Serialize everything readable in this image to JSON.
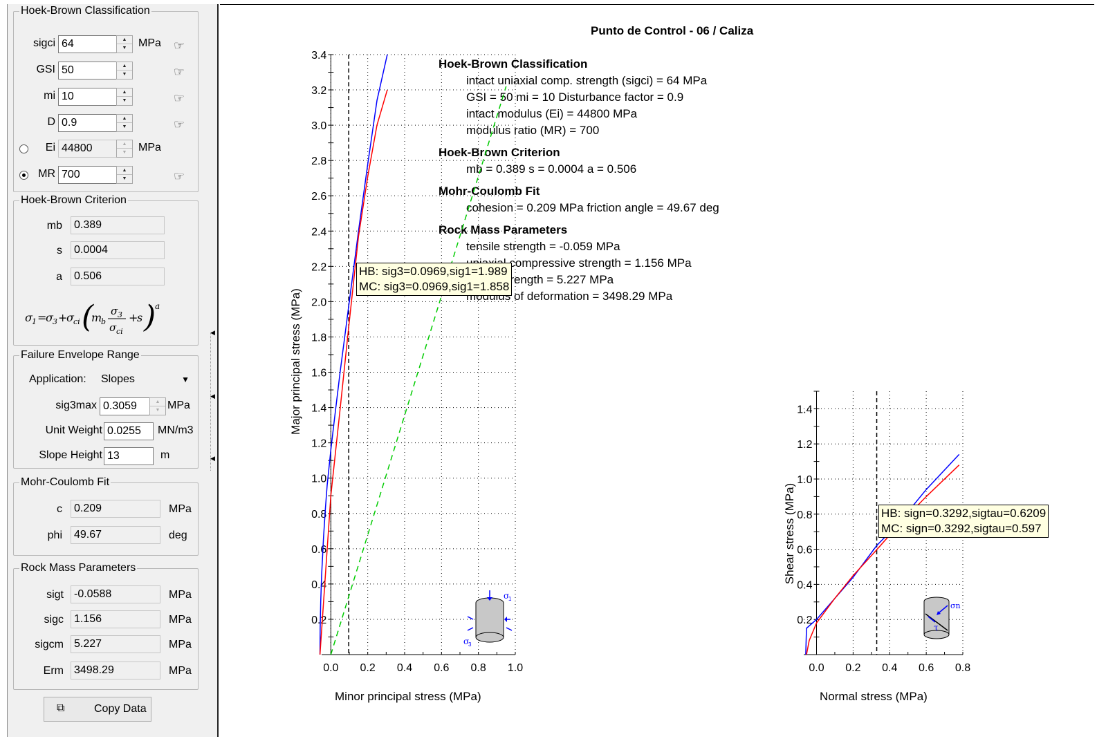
{
  "colors": {
    "hb": "#0000ff",
    "mc": "#ff0000",
    "uniaxial": "#00cc00"
  },
  "left_panel": {
    "hb_classification": {
      "title": "Hoek-Brown Classification",
      "sigci": {
        "label": "sigci",
        "value": "64",
        "unit": "MPa"
      },
      "gsi": {
        "label": "GSI",
        "value": "50"
      },
      "mi": {
        "label": "mi",
        "value": "10"
      },
      "d": {
        "label": "D",
        "value": "0.9"
      },
      "ei": {
        "label": "Ei",
        "value": "44800",
        "unit": "MPa",
        "selected": false
      },
      "mr": {
        "label": "MR",
        "value": "700",
        "selected": true
      }
    },
    "hb_criterion": {
      "title": "Hoek-Brown Criterion",
      "mb": {
        "label": "mb",
        "value": "0.389"
      },
      "s": {
        "label": "s",
        "value": "0.0004"
      },
      "a": {
        "label": "a",
        "value": "0.506"
      }
    },
    "failure_envelope": {
      "title": "Failure Envelope Range",
      "application": {
        "label": "Application:",
        "value": "Slopes"
      },
      "sig3max": {
        "label": "sig3max",
        "value": "0.3059",
        "unit": "MPa"
      },
      "unit_weight": {
        "label": "Unit Weight",
        "value": "0.0255",
        "unit": "MN/m3"
      },
      "slope_height": {
        "label": "Slope Height",
        "value": "13",
        "unit": "m"
      }
    },
    "mohr_coulomb": {
      "title": "Mohr-Coulomb Fit",
      "c": {
        "label": "c",
        "value": "0.209",
        "unit": "MPa"
      },
      "phi": {
        "label": "phi",
        "value": "49.67",
        "unit": "deg"
      }
    },
    "rock_mass": {
      "title": "Rock Mass Parameters",
      "sigt": {
        "label": "sigt",
        "value": "-0.0588",
        "unit": "MPa"
      },
      "sigc": {
        "label": "sigc",
        "value": "1.156",
        "unit": "MPa"
      },
      "sigcm": {
        "label": "sigcm",
        "value": "5.227",
        "unit": "MPa"
      },
      "erm": {
        "label": "Erm",
        "value": "3498.29",
        "unit": "MPa"
      }
    },
    "copy_button": "Copy Data"
  },
  "report": {
    "title": "Punto de Control - 06 / Caliza",
    "sections": [
      {
        "heading": "Hoek-Brown Classification",
        "lines": [
          "intact uniaxial comp. strength (sigci) = 64 MPa",
          "GSI = 50    mi = 10    Disturbance factor = 0.9",
          "intact modulus (Ei) = 44800 MPa",
          "modulus ratio (MR) = 700"
        ]
      },
      {
        "heading": "Hoek-Brown Criterion",
        "lines": [
          "mb = 0.389    s = 0.0004    a = 0.506"
        ]
      },
      {
        "heading": "Mohr-Coulomb Fit",
        "lines": [
          "cohesion = 0.209 MPa    friction angle = 49.67 deg"
        ]
      },
      {
        "heading": "Rock Mass Parameters",
        "lines": [
          "tensile strength = -0.059 MPa",
          "uniaxial compressive strength = 1.156 MPa",
          "global strength = 5.227 MPa",
          "modulus of deformation = 3498.29 MPa"
        ]
      }
    ]
  },
  "chart_data": [
    {
      "type": "line",
      "xlabel": "Minor principal stress (MPa)",
      "ylabel": "Major principal stress (MPa)",
      "xlim": [
        -0.05,
        1.0
      ],
      "ylim": [
        0.0,
        3.4
      ],
      "xticks": [
        "0.0",
        "0.2",
        "0.4",
        "0.6",
        "0.8",
        "1.0"
      ],
      "xtick_values": [
        0.0,
        0.2,
        0.4,
        0.6,
        0.8,
        1.0
      ],
      "yticks": [
        "0.2",
        "0.4",
        "0.6",
        "0.8",
        "1.0",
        "1.2",
        "1.4",
        "1.6",
        "1.8",
        "2.0",
        "2.2",
        "2.4",
        "2.6",
        "2.8",
        "3.0",
        "3.2",
        "3.4"
      ],
      "ytick_values": [
        0.2,
        0.4,
        0.6,
        0.8,
        1.0,
        1.2,
        1.4,
        1.6,
        1.8,
        2.0,
        2.2,
        2.4,
        2.6,
        2.8,
        3.0,
        3.2,
        3.4
      ],
      "grid": true,
      "marker_x": 0.0969,
      "series": [
        {
          "color": "#0000ff",
          "x": [
            -0.059,
            -0.058,
            -0.055,
            -0.05,
            -0.04,
            -0.03,
            -0.02,
            0.0,
            0.02,
            0.05,
            0.08,
            0.1,
            0.15,
            0.2,
            0.25,
            0.3059
          ],
          "y": [
            0.0,
            0.15,
            0.3,
            0.45,
            0.66,
            0.82,
            0.96,
            1.16,
            1.34,
            1.6,
            1.84,
            2.0,
            2.4,
            2.78,
            3.14,
            3.55
          ]
        },
        {
          "color": "#ff0000",
          "x": [
            -0.059,
            0.0,
            0.05,
            0.0969,
            0.15,
            0.2,
            0.25,
            0.3059
          ],
          "y": [
            0.0,
            0.9,
            1.39,
            1.858,
            2.37,
            2.71,
            3.0,
            3.2
          ]
        },
        {
          "color": "#00cc00",
          "dashed": true,
          "x": [
            0.0,
            0.95
          ],
          "y": [
            0.0,
            3.22
          ]
        }
      ],
      "tooltip": [
        "HB: sig3=0.0969,sig1=1.989",
        "MC: sig3=0.0969,sig1=1.858"
      ]
    },
    {
      "type": "line",
      "xlabel": "Normal stress (MPa)",
      "ylabel": "Shear stress (MPa)",
      "xlim": [
        -0.07,
        0.8
      ],
      "ylim": [
        0.0,
        1.5
      ],
      "xticks": [
        "0.0",
        "0.2",
        "0.4",
        "0.6",
        "0.8"
      ],
      "xtick_values": [
        0.0,
        0.2,
        0.4,
        0.6,
        0.8
      ],
      "yticks": [
        "0.2",
        "0.4",
        "0.6",
        "0.8",
        "1.0",
        "1.2",
        "1.4"
      ],
      "ytick_values": [
        0.2,
        0.4,
        0.6,
        0.8,
        1.0,
        1.2,
        1.4
      ],
      "grid": true,
      "marker_x": 0.3292,
      "series": [
        {
          "color": "#0000ff",
          "x": [
            -0.059,
            -0.055,
            0.0,
            0.1,
            0.2,
            0.3292,
            0.45,
            0.6,
            0.78
          ],
          "y": [
            0.0,
            0.15,
            0.2,
            0.32,
            0.44,
            0.6209,
            0.75,
            0.94,
            1.14
          ]
        },
        {
          "color": "#ff0000",
          "x": [
            -0.055,
            -0.04,
            0.0,
            0.1,
            0.2,
            0.3292,
            0.45,
            0.6,
            0.78
          ],
          "y": [
            0.0,
            0.08,
            0.18,
            0.32,
            0.45,
            0.597,
            0.74,
            0.9,
            1.08
          ]
        }
      ],
      "tooltip": [
        "HB: sign=0.3292,sigtau=0.6209",
        "MC: sign=0.3292,sigtau=0.597"
      ]
    }
  ]
}
